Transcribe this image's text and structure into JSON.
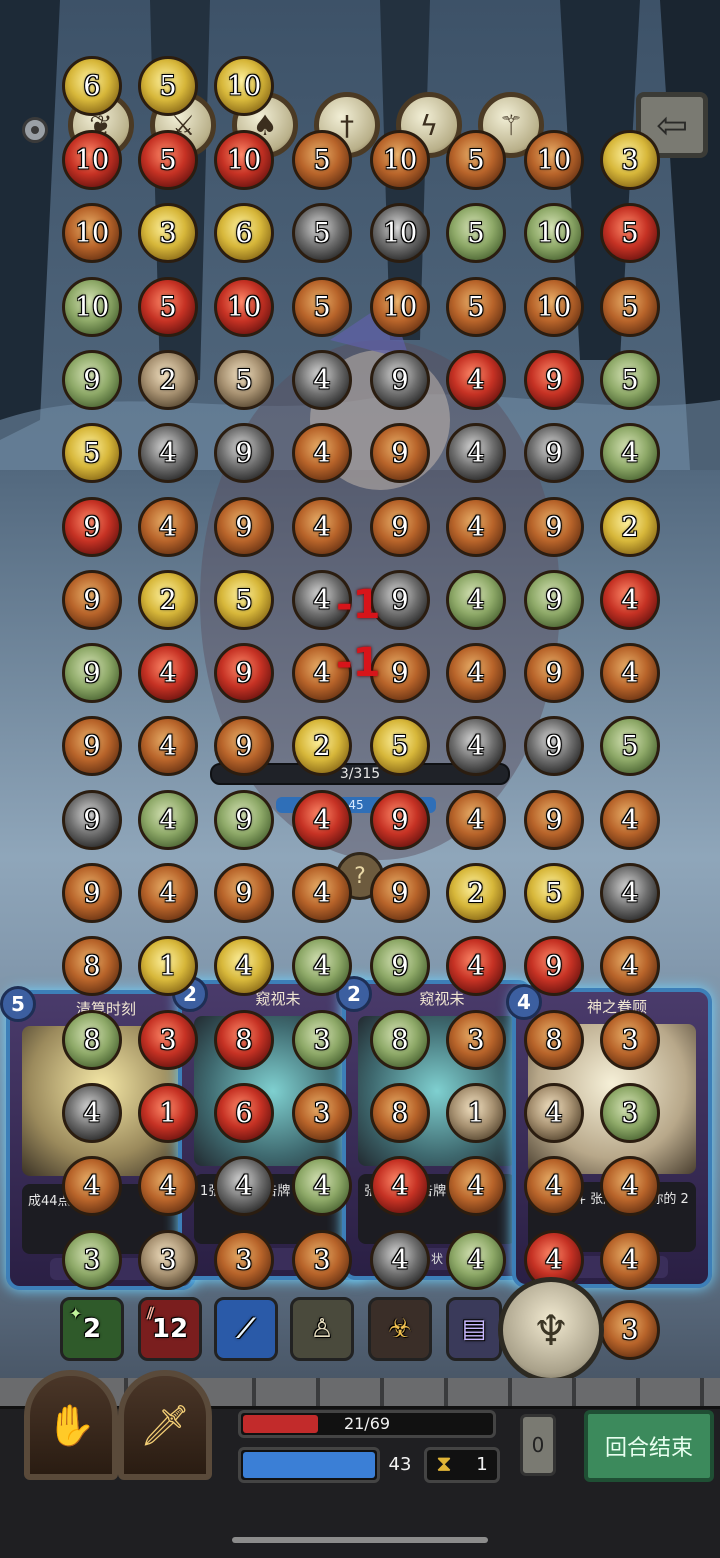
{
  "relics": [
    {
      "icon": "fish-skeleton-icon"
    },
    {
      "icon": "crossed-swords-icon"
    },
    {
      "icon": "bat-icon"
    },
    {
      "icon": "sword-icon"
    },
    {
      "icon": "lightning-figure-icon"
    },
    {
      "icon": "staff-icon"
    }
  ],
  "top_coin_values": [
    "6",
    "5",
    "10"
  ],
  "coin_rows": [
    [
      {
        "v": "10",
        "t": "r"
      },
      {
        "v": "5",
        "t": "r"
      },
      {
        "v": "10",
        "t": "r"
      },
      {
        "v": "5",
        "t": "o"
      },
      {
        "v": "10",
        "t": "o"
      },
      {
        "v": "5",
        "t": "o"
      },
      {
        "v": "10",
        "t": "o"
      },
      {
        "v": "3",
        "t": "y"
      }
    ],
    [
      {
        "v": "10",
        "t": "o"
      },
      {
        "v": "3",
        "t": "y"
      },
      {
        "v": "6",
        "t": "y"
      },
      {
        "v": "5",
        "t": "d"
      },
      {
        "v": "10",
        "t": "d"
      },
      {
        "v": "5",
        "t": "g"
      },
      {
        "v": "10",
        "t": "g"
      },
      {
        "v": "5",
        "t": "r"
      }
    ],
    [
      {
        "v": "10",
        "t": "g"
      },
      {
        "v": "5",
        "t": "r"
      },
      {
        "v": "10",
        "t": "r"
      },
      {
        "v": "5",
        "t": "o"
      },
      {
        "v": "10",
        "t": "o"
      },
      {
        "v": "5",
        "t": "o"
      },
      {
        "v": "10",
        "t": "o"
      },
      {
        "v": "5",
        "t": "o"
      }
    ],
    [
      {
        "v": "9",
        "t": "g"
      },
      {
        "v": "2",
        "t": "t"
      },
      {
        "v": "5",
        "t": "t"
      },
      {
        "v": "4",
        "t": "d"
      },
      {
        "v": "9",
        "t": "d"
      },
      {
        "v": "4",
        "t": "r"
      },
      {
        "v": "9",
        "t": "r"
      },
      {
        "v": "5",
        "t": "g"
      }
    ],
    [
      {
        "v": "5",
        "t": "y"
      },
      {
        "v": "4",
        "t": "d"
      },
      {
        "v": "9",
        "t": "d"
      },
      {
        "v": "4",
        "t": "o"
      },
      {
        "v": "9",
        "t": "o"
      },
      {
        "v": "4",
        "t": "d"
      },
      {
        "v": "9",
        "t": "d"
      },
      {
        "v": "4",
        "t": "g"
      }
    ],
    [
      {
        "v": "9",
        "t": "r"
      },
      {
        "v": "4",
        "t": "o"
      },
      {
        "v": "9",
        "t": "o"
      },
      {
        "v": "4",
        "t": "o"
      },
      {
        "v": "9",
        "t": "o"
      },
      {
        "v": "4",
        "t": "o"
      },
      {
        "v": "9",
        "t": "o"
      },
      {
        "v": "2",
        "t": "y"
      }
    ],
    [
      {
        "v": "9",
        "t": "o"
      },
      {
        "v": "2",
        "t": "y"
      },
      {
        "v": "5",
        "t": "y"
      },
      {
        "v": "4",
        "t": "d"
      },
      {
        "v": "9",
        "t": "d"
      },
      {
        "v": "4",
        "t": "g"
      },
      {
        "v": "9",
        "t": "g"
      },
      {
        "v": "4",
        "t": "r"
      }
    ],
    [
      {
        "v": "9",
        "t": "g"
      },
      {
        "v": "4",
        "t": "r"
      },
      {
        "v": "9",
        "t": "r"
      },
      {
        "v": "4",
        "t": "o"
      },
      {
        "v": "9",
        "t": "o"
      },
      {
        "v": "4",
        "t": "o"
      },
      {
        "v": "9",
        "t": "o"
      },
      {
        "v": "4",
        "t": "o"
      }
    ],
    [
      {
        "v": "9",
        "t": "o"
      },
      {
        "v": "4",
        "t": "o"
      },
      {
        "v": "9",
        "t": "o"
      },
      {
        "v": "2",
        "t": "y"
      },
      {
        "v": "5",
        "t": "y"
      },
      {
        "v": "4",
        "t": "d"
      },
      {
        "v": "9",
        "t": "d"
      },
      {
        "v": "5",
        "t": "g"
      }
    ],
    [
      {
        "v": "9",
        "t": "d"
      },
      {
        "v": "4",
        "t": "g"
      },
      {
        "v": "9",
        "t": "g"
      },
      {
        "v": "4",
        "t": "r"
      },
      {
        "v": "9",
        "t": "r"
      },
      {
        "v": "4",
        "t": "o"
      },
      {
        "v": "9",
        "t": "o"
      },
      {
        "v": "4",
        "t": "o"
      }
    ],
    [
      {
        "v": "9",
        "t": "o"
      },
      {
        "v": "4",
        "t": "o"
      },
      {
        "v": "9",
        "t": "o"
      },
      {
        "v": "4",
        "t": "o"
      },
      {
        "v": "9",
        "t": "o"
      },
      {
        "v": "2",
        "t": "y"
      },
      {
        "v": "5",
        "t": "y"
      },
      {
        "v": "4",
        "t": "d"
      }
    ],
    [
      {
        "v": "8",
        "t": "o"
      },
      {
        "v": "1",
        "t": "y"
      },
      {
        "v": "4",
        "t": "y"
      },
      {
        "v": "4",
        "t": "g"
      },
      {
        "v": "9",
        "t": "g"
      },
      {
        "v": "4",
        "t": "r"
      },
      {
        "v": "9",
        "t": "r"
      },
      {
        "v": "4",
        "t": "o"
      }
    ],
    [
      {
        "v": "8",
        "t": "g"
      },
      {
        "v": "3",
        "t": "r"
      },
      {
        "v": "8",
        "t": "r"
      },
      {
        "v": "3",
        "t": "g"
      },
      {
        "v": "8",
        "t": "g"
      },
      {
        "v": "3",
        "t": "o"
      },
      {
        "v": "8",
        "t": "o"
      },
      {
        "v": "3",
        "t": "o"
      }
    ],
    [
      {
        "v": "4",
        "t": "d"
      },
      {
        "v": "1",
        "t": "r"
      },
      {
        "v": "6",
        "t": "r"
      },
      {
        "v": "3",
        "t": "o"
      },
      {
        "v": "8",
        "t": "o"
      },
      {
        "v": "1",
        "t": "t"
      },
      {
        "v": "4",
        "t": "t"
      },
      {
        "v": "3",
        "t": "g"
      }
    ],
    [
      {
        "v": "4",
        "t": "o"
      },
      {
        "v": "4",
        "t": "o"
      },
      {
        "v": "4",
        "t": "d"
      },
      {
        "v": "4",
        "t": "g"
      },
      {
        "v": "4",
        "t": "r"
      },
      {
        "v": "4",
        "t": "o"
      },
      {
        "v": "4",
        "t": "o"
      },
      {
        "v": "4",
        "t": "o"
      }
    ],
    [
      {
        "v": "3",
        "t": "g"
      },
      {
        "v": "3",
        "t": "t"
      },
      {
        "v": "3",
        "t": "o"
      },
      {
        "v": "3",
        "t": "o"
      },
      {
        "v": "4",
        "t": "d"
      },
      {
        "v": "4",
        "t": "g"
      },
      {
        "v": "4",
        "t": "r"
      },
      {
        "v": "4",
        "t": "o"
      }
    ],
    [
      {
        "v": "3",
        "t": "o"
      }
    ]
  ],
  "enemy": {
    "hp_text": "3/315",
    "shield_text": "45",
    "intent_icon": "question-icon"
  },
  "damage_popups": [
    "-1",
    "-1"
  ],
  "cards": [
    {
      "cost": "5",
      "title": "清算时刻",
      "text": "成44点伤",
      "tag": "咒"
    },
    {
      "cost": "2",
      "title": "窥视未",
      "text": "1张 当前传告牌 快1回",
      "tag": ""
    },
    {
      "cost": "2",
      "title": "窥视未",
      "text": "张 当前传告牌 快1回合",
      "tag": "状"
    },
    {
      "cost": "4",
      "title": "神之眷顾",
      "text": "本次战斗 张牌 开始 你的 2",
      "tag": ""
    }
  ],
  "buffs": [
    {
      "icon": "sparkle-hand-icon",
      "value": "2"
    },
    {
      "icon": "claw-strike-icon",
      "value": "12"
    },
    {
      "icon": "slash-icon",
      "value": ""
    },
    {
      "icon": "priest-icon",
      "value": ""
    },
    {
      "icon": "beast-icon",
      "value": ""
    },
    {
      "icon": "book-icon",
      "value": ""
    }
  ],
  "candelabra_icon": "candelabra-icon",
  "hud": {
    "hp_text": "21/69",
    "hp_fraction": 0.304,
    "mana": "43",
    "turn_counter": "1",
    "deck_count": "0",
    "end_turn_label": "回合结束"
  },
  "colors": {
    "hp": "#c22b2b",
    "mana": "#3b7fd6",
    "end_turn": "#3c8a5c",
    "card_glow": "#6fd3ff"
  }
}
